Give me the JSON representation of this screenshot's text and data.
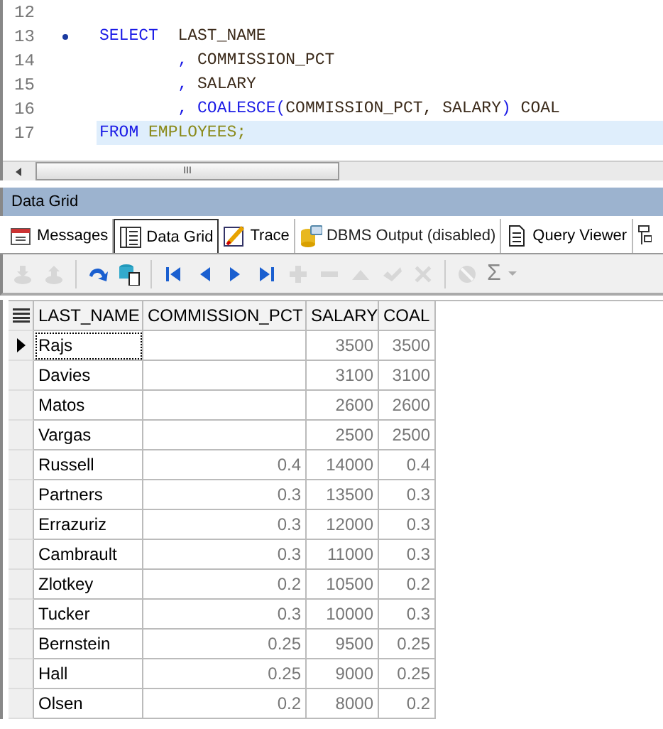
{
  "editor": {
    "lines": [
      {
        "number": "12",
        "marker": false,
        "current": false
      },
      {
        "number": "13",
        "marker": true,
        "current": false,
        "tokens": [
          {
            "text": "SELECT",
            "kind": "keyword"
          },
          {
            "text": "  LAST_NAME",
            "kind": "ident"
          }
        ]
      },
      {
        "number": "14",
        "marker": false,
        "current": false,
        "tokens": [
          {
            "text": "        ,",
            "kind": "punct"
          },
          {
            "text": " COMMISSION_PCT",
            "kind": "ident"
          }
        ]
      },
      {
        "number": "15",
        "marker": false,
        "current": false,
        "tokens": [
          {
            "text": "        ,",
            "kind": "punct"
          },
          {
            "text": " SALARY",
            "kind": "ident"
          }
        ]
      },
      {
        "number": "16",
        "marker": false,
        "current": false,
        "tokens": [
          {
            "text": "        ,",
            "kind": "punct"
          },
          {
            "text": " COALESCE",
            "kind": "function"
          },
          {
            "text": "(",
            "kind": "punct"
          },
          {
            "text": "COMMISSION_PCT, SALARY",
            "kind": "ident"
          },
          {
            "text": ")",
            "kind": "punct"
          },
          {
            "text": " COAL",
            "kind": "ident"
          }
        ]
      },
      {
        "number": "17",
        "marker": false,
        "current": true,
        "tokens": [
          {
            "text": "FROM",
            "kind": "keyword"
          },
          {
            "text": " EMPLOYEES;",
            "kind": "table"
          }
        ]
      }
    ],
    "scroll_grip": "III"
  },
  "panel": {
    "title": "Data Grid"
  },
  "tabs": [
    {
      "label": "Messages",
      "selected": false,
      "kind": "messages"
    },
    {
      "label": "Data Grid",
      "selected": true,
      "kind": "grid"
    },
    {
      "label": "Trace",
      "selected": false,
      "kind": "trace"
    },
    {
      "label": "DBMS Output (disabled)",
      "selected": false,
      "kind": "dbms"
    },
    {
      "label": "Query Viewer",
      "selected": false,
      "kind": "viewer"
    }
  ],
  "toolbar": [
    {
      "kind": "import",
      "disabled": true
    },
    {
      "kind": "export",
      "disabled": true
    },
    {
      "kind": "sep"
    },
    {
      "kind": "refresh",
      "disabled": false
    },
    {
      "kind": "database",
      "disabled": false
    },
    {
      "kind": "sep"
    },
    {
      "kind": "first",
      "disabled": false
    },
    {
      "kind": "prev",
      "disabled": false
    },
    {
      "kind": "next",
      "disabled": false
    },
    {
      "kind": "last",
      "disabled": false
    },
    {
      "kind": "add",
      "disabled": true
    },
    {
      "kind": "remove",
      "disabled": true
    },
    {
      "kind": "up",
      "disabled": true
    },
    {
      "kind": "check",
      "disabled": true
    },
    {
      "kind": "cancel",
      "disabled": true
    },
    {
      "kind": "sep"
    },
    {
      "kind": "clear",
      "disabled": true
    },
    {
      "kind": "sum",
      "label": "Σ",
      "disabled": true
    }
  ],
  "table": {
    "columns": [
      "LAST_NAME",
      "COMMISSION_PCT",
      "SALARY",
      "COAL"
    ],
    "rows": [
      {
        "cells": [
          "Rajs",
          "",
          "3500",
          "3500"
        ],
        "selected": true
      },
      {
        "cells": [
          "Davies",
          "",
          "3100",
          "3100"
        ],
        "selected": false
      },
      {
        "cells": [
          "Matos",
          "",
          "2600",
          "2600"
        ],
        "selected": false
      },
      {
        "cells": [
          "Vargas",
          "",
          "2500",
          "2500"
        ],
        "selected": false
      },
      {
        "cells": [
          "Russell",
          "0.4",
          "14000",
          "0.4"
        ],
        "selected": false
      },
      {
        "cells": [
          "Partners",
          "0.3",
          "13500",
          "0.3"
        ],
        "selected": false
      },
      {
        "cells": [
          "Errazuriz",
          "0.3",
          "12000",
          "0.3"
        ],
        "selected": false
      },
      {
        "cells": [
          "Cambrault",
          "0.3",
          "11000",
          "0.3"
        ],
        "selected": false
      },
      {
        "cells": [
          "Zlotkey",
          "0.2",
          "10500",
          "0.2"
        ],
        "selected": false
      },
      {
        "cells": [
          "Tucker",
          "0.3",
          "10000",
          "0.3"
        ],
        "selected": false
      },
      {
        "cells": [
          "Bernstein",
          "0.25",
          "9500",
          "0.25"
        ],
        "selected": false
      },
      {
        "cells": [
          "Hall",
          "0.25",
          "9000",
          "0.25"
        ],
        "selected": false
      },
      {
        "cells": [
          "Olsen",
          "0.2",
          "8000",
          "0.2"
        ],
        "selected": false
      }
    ]
  }
}
